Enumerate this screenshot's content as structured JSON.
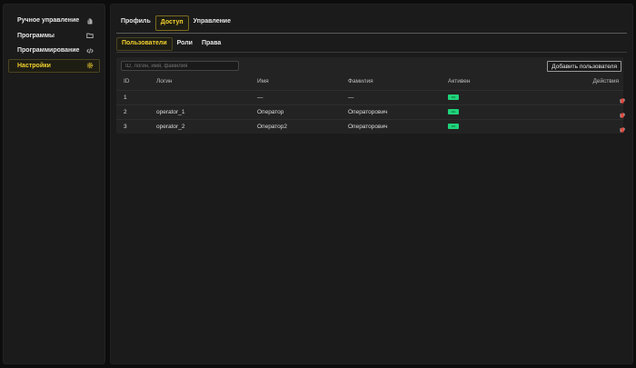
{
  "sidebar": {
    "items": [
      {
        "label": "Ручное управление",
        "icon": "hand-icon",
        "active": false
      },
      {
        "label": "Программы",
        "icon": "folder-icon",
        "active": false
      },
      {
        "label": "Программирование",
        "icon": "code-icon",
        "active": false
      },
      {
        "label": "Настройки",
        "icon": "gear-icon",
        "active": true
      }
    ]
  },
  "tabs": [
    {
      "label": "Профиль",
      "active": false
    },
    {
      "label": "Доступ",
      "active": true
    },
    {
      "label": "Управление",
      "active": false
    }
  ],
  "subtabs": [
    {
      "label": "Пользователи",
      "active": true
    },
    {
      "label": "Роли",
      "active": false
    },
    {
      "label": "Права",
      "active": false
    }
  ],
  "search": {
    "placeholder": "ID, логин, имя, фамилия"
  },
  "add_button": "Добавить пользователя",
  "table": {
    "columns": [
      "ID",
      "Логин",
      "Имя",
      "Фамилия",
      "Активен",
      "Действия"
    ],
    "rows": [
      {
        "id": "1",
        "login": "",
        "name": "—",
        "surname": "—",
        "active": true
      },
      {
        "id": "2",
        "login": "operator_1",
        "name": "Оператор",
        "surname": "Операторович",
        "active": true
      },
      {
        "id": "3",
        "login": "operator_2",
        "name": "Оператор2",
        "surname": "Операторович",
        "active": true
      }
    ],
    "row_actions": [
      "edit-icon",
      "key-icon",
      "reset-icon",
      "delete-icon"
    ]
  },
  "colors": {
    "accent": "#f2d22e",
    "active_badge": "#1fd37a",
    "delete": "#e0453a"
  }
}
